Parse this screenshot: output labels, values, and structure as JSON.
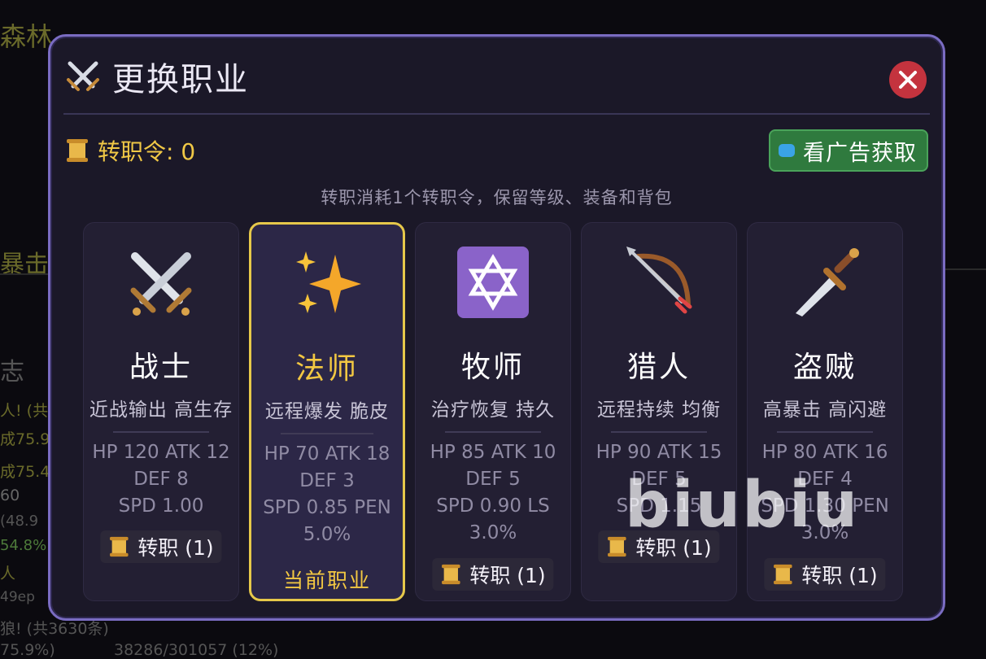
{
  "background": {
    "fragments": [
      "森林",
      "暴击",
      "志",
      "人! (共",
      "成75.9",
      "成75.4",
      "60",
      "(48.9",
      "54.8%",
      "人",
      "49ep",
      "狼! (共3630条)",
      "75.9%)",
      "38286/301057 (12%)"
    ]
  },
  "modal": {
    "title": "更换职业",
    "title_icon": "crossed-swords-icon",
    "close_icon": "close-icon",
    "token_label": "转职令: 0",
    "ad_button": "看广告获取",
    "hint": "转职消耗1个转职令，保留等级、装备和背包"
  },
  "classes": [
    {
      "icon": "crossed-swords-icon",
      "name": "战士",
      "desc": "近战输出 高生存",
      "stats": [
        "HP 120 ATK 12",
        "DEF 8",
        "SPD 1.00"
      ],
      "button": "转职 (1)"
    },
    {
      "icon": "sparkles-icon",
      "name": "法师",
      "desc": "远程爆发 脆皮",
      "stats": [
        "HP 70 ATK 18",
        "DEF 3",
        "SPD 0.85 PEN",
        "5.0%"
      ],
      "current_label": "当前职业",
      "current": true
    },
    {
      "icon": "star-of-david-icon",
      "name": "牧师",
      "desc": "治疗恢复 持久",
      "stats": [
        "HP 85 ATK 10",
        "DEF 5",
        "SPD 0.90 LS",
        "3.0%"
      ],
      "button": "转职 (1)"
    },
    {
      "icon": "bow-and-arrow-icon",
      "name": "猎人",
      "desc": "远程持续 均衡",
      "stats": [
        "HP 90 ATK 15",
        "DEF 5",
        "SPD 1.15"
      ],
      "button": "转职 (1)"
    },
    {
      "icon": "dagger-icon",
      "name": "盗贼",
      "desc": "高暴击 高闪避",
      "stats": [
        "HP 80 ATK 16",
        "DEF 4",
        "SPD 1.30 PEN",
        "3.0%"
      ],
      "button": "转职 (1)"
    }
  ],
  "watermark": "biubiu",
  "colors": {
    "panel": "#1b1828",
    "border": "#7a6cc2",
    "accent_gold": "#f3c842",
    "close_red": "#c4333e",
    "ad_green": "#2f7a3e"
  }
}
